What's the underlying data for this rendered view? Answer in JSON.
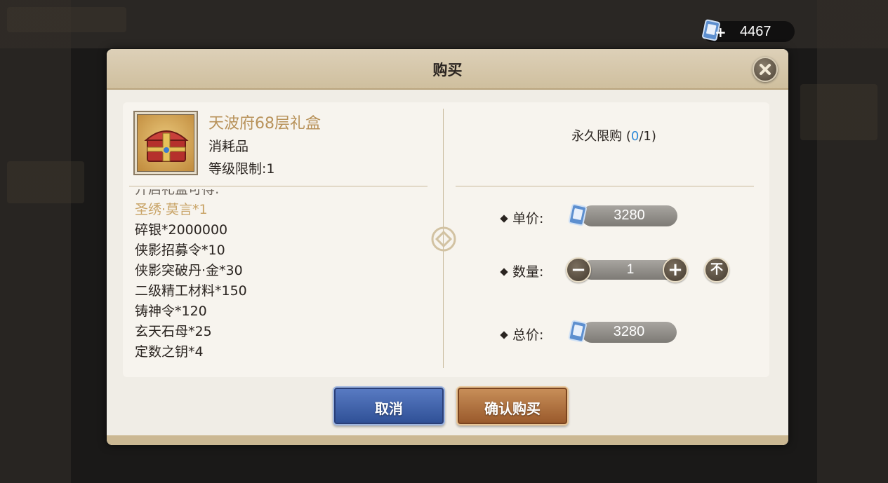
{
  "currency": {
    "icon": "ticket-icon",
    "plus": "+",
    "amount": "4467"
  },
  "dialog": {
    "title": "购买",
    "close_icon": "close-icon"
  },
  "item": {
    "name": "天波府68层礼盒",
    "type": "消耗品",
    "level_limit": "等级限制:1",
    "contents_partial_top": "开启礼盒可得:",
    "contents": [
      {
        "text": "圣绣·莫言*1",
        "highlight": true
      },
      {
        "text": "碎银*2000000",
        "highlight": false
      },
      {
        "text": "侠影招募令*10",
        "highlight": false
      },
      {
        "text": "侠影突破丹·金*30",
        "highlight": false
      },
      {
        "text": "二级精工材料*150",
        "highlight": false
      },
      {
        "text": "铸神令*120",
        "highlight": false
      },
      {
        "text": "玄天石母*25",
        "highlight": false
      },
      {
        "text": "定数之钥*4",
        "highlight": false
      }
    ]
  },
  "purchase": {
    "limit_label": "永久限购 (",
    "limit_current": "0",
    "limit_total": "/1)",
    "unit_price_label": "单价:",
    "unit_price": "3280",
    "quantity_label": "数量:",
    "quantity": "1",
    "minus": "−",
    "plus": "+",
    "max_glyph": "不",
    "total_label": "总价:",
    "total_price": "3280"
  },
  "buttons": {
    "cancel": "取消",
    "confirm": "确认购买"
  },
  "colors": {
    "gold_text": "#b8925a",
    "limit_blue": "#2f8ad8",
    "cancel_blue": "#3a5ca8",
    "confirm_brown": "#b07340"
  }
}
